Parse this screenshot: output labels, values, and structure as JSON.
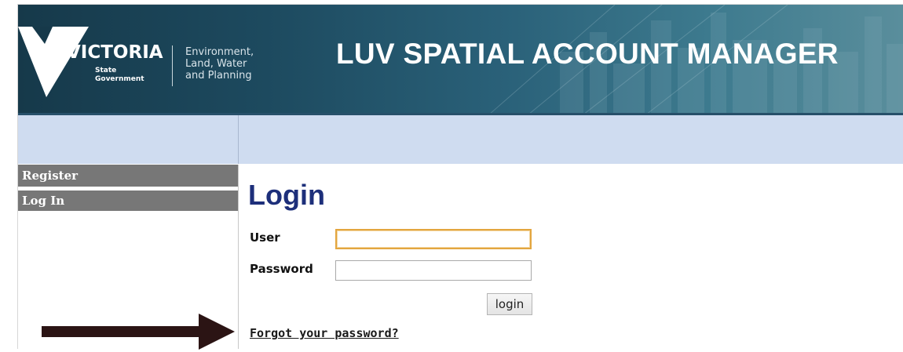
{
  "header": {
    "logo": {
      "wordmark": "VICTORIA",
      "subtitle_line1": "State",
      "subtitle_line2": "Government"
    },
    "department": {
      "line1": "Environment,",
      "line2": "Land, Water",
      "line3": "and Planning"
    },
    "app_title": "LUV SPATIAL ACCOUNT MANAGER"
  },
  "sidebar": {
    "items": [
      {
        "label": "Register"
      },
      {
        "label": "Log In"
      }
    ]
  },
  "main": {
    "title": "Login",
    "user_label": "User",
    "user_value": "",
    "password_label": "Password",
    "password_value": "",
    "login_button": "login",
    "forgot_link": "Forgot your password?"
  },
  "annotation": {
    "arrow_color": "#2b1414"
  },
  "colors": {
    "banner": "#1d4a5f",
    "subbar": "#cfdcf0",
    "nav_item": "#777777",
    "title": "#1d2f7a",
    "input_focus": "#e3a63f"
  }
}
